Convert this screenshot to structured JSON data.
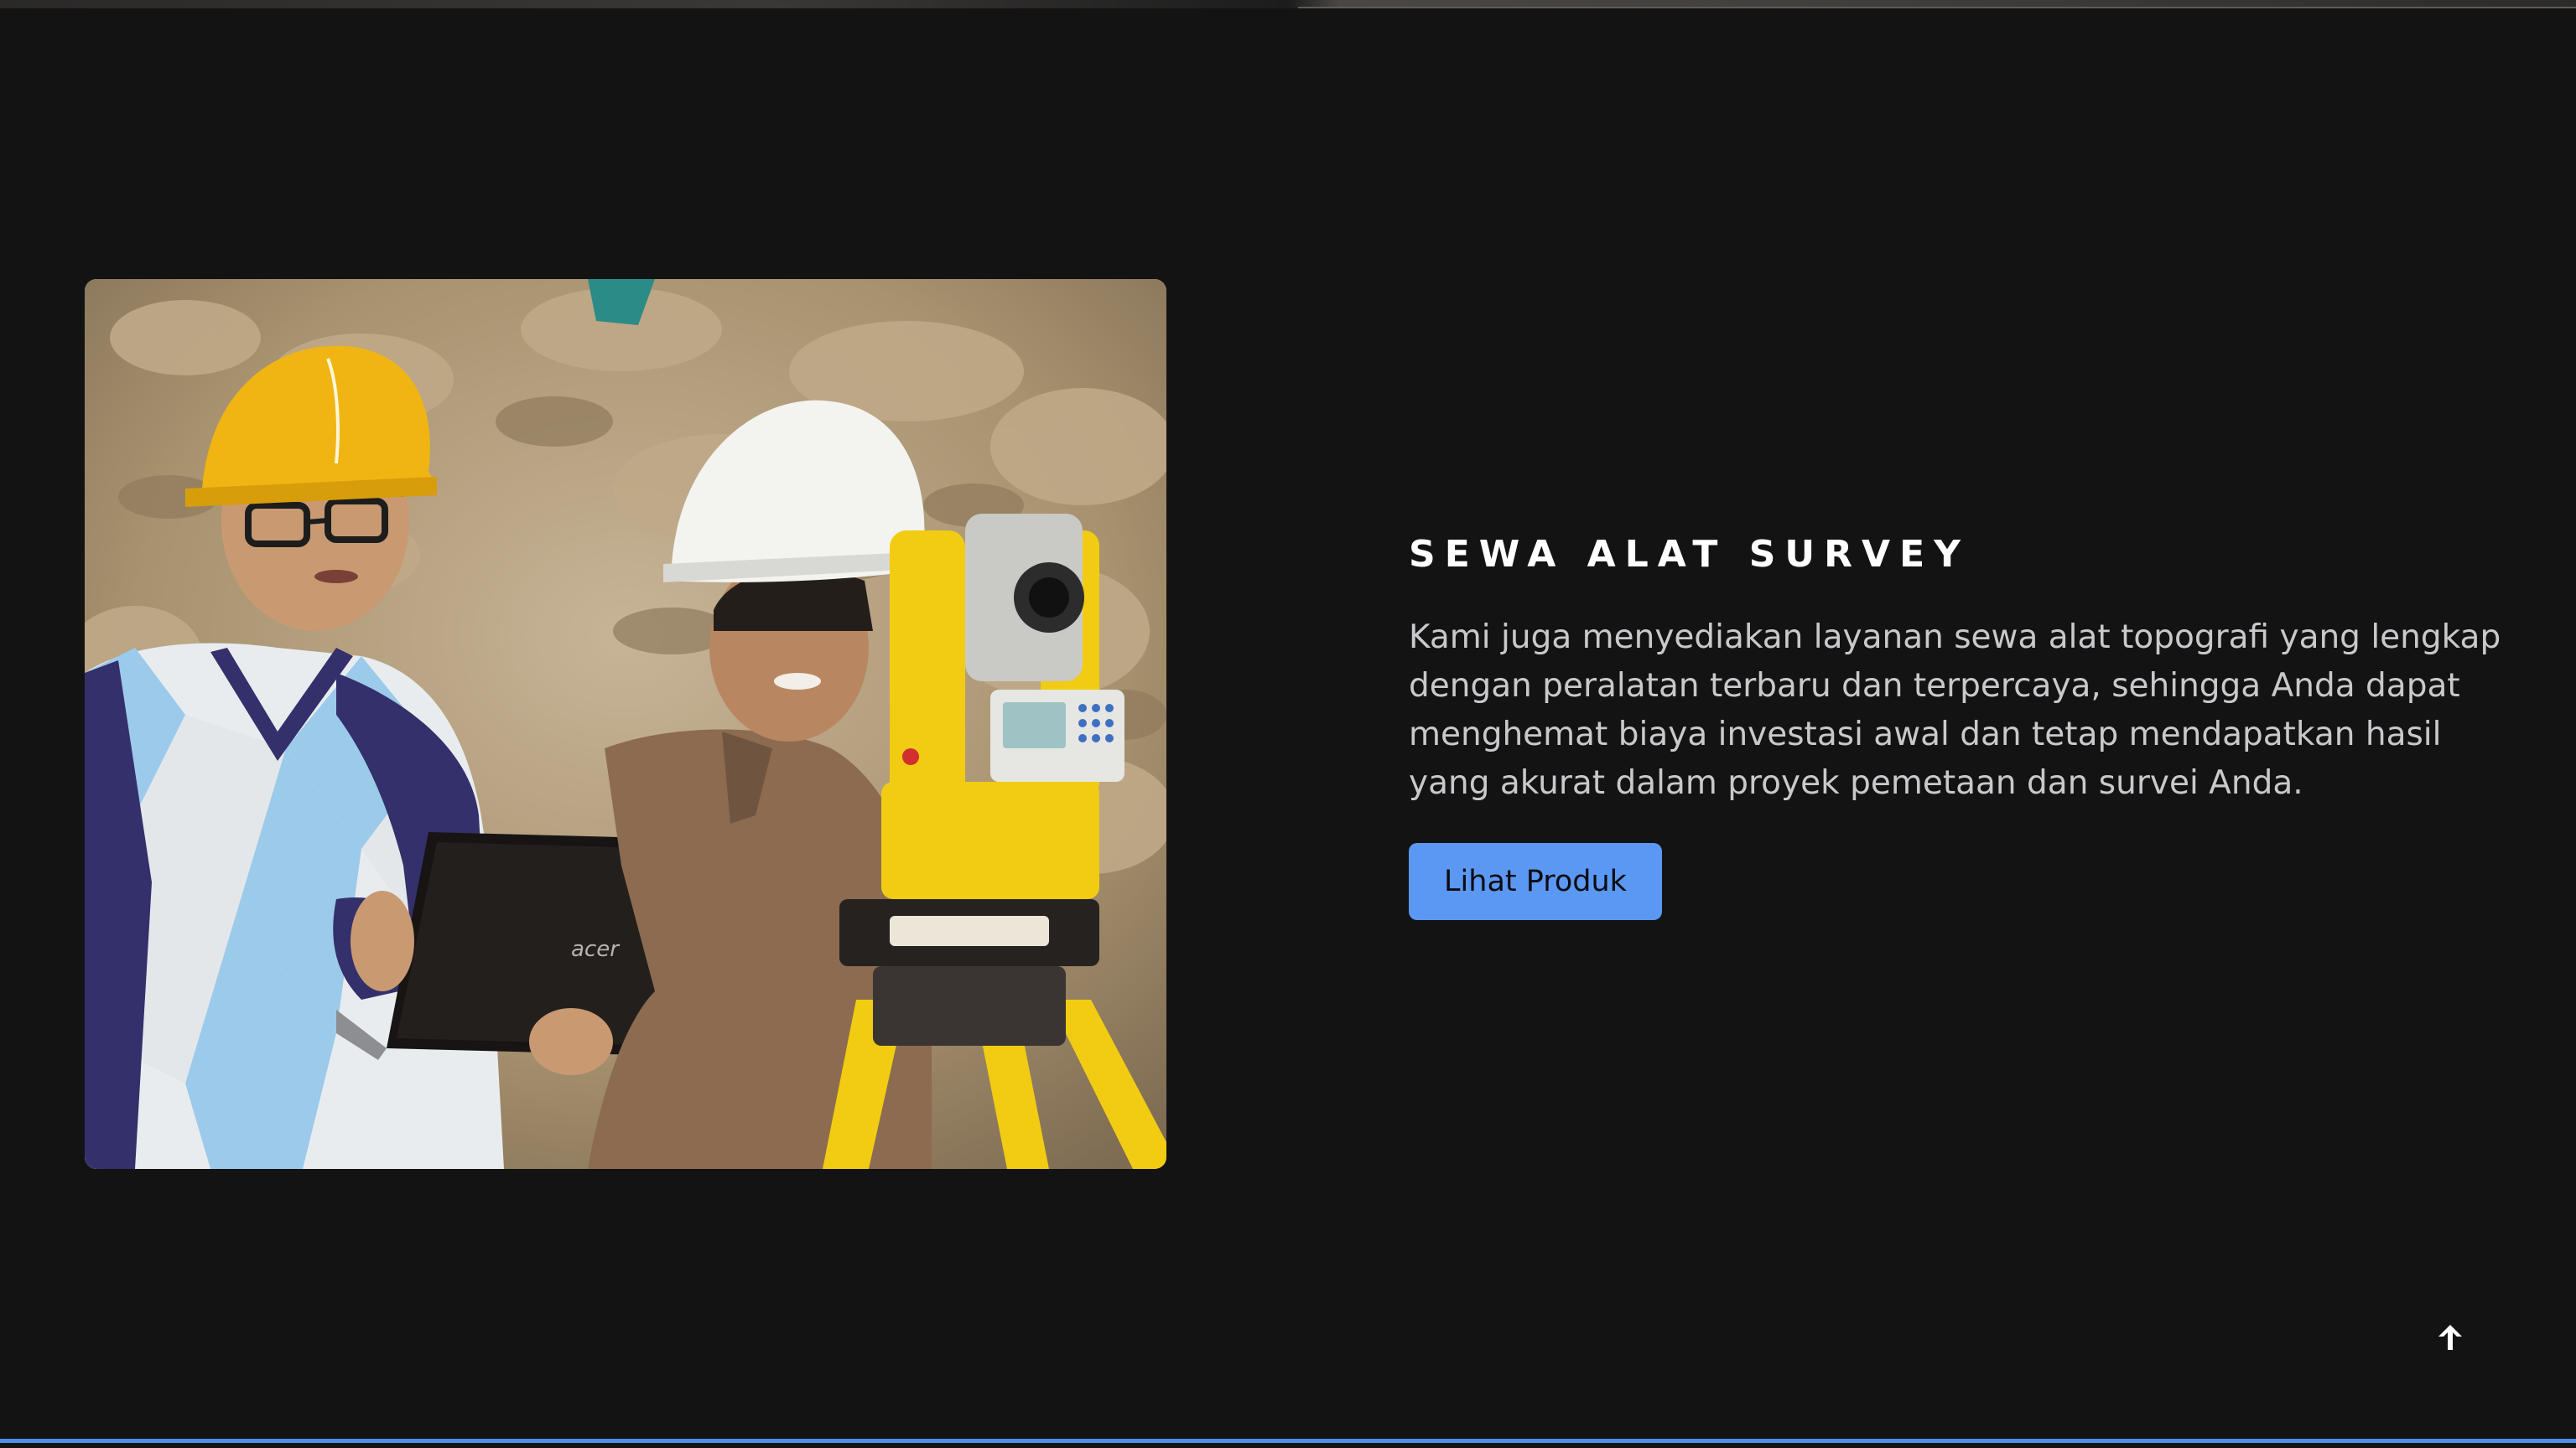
{
  "section": {
    "heading": "SEWA ALAT SURVEY",
    "description": "Kami juga menyediakan layanan sewa alat topografi yang lengkap dengan peralatan terbaru dan terpercaya, sehingga Anda dapat menghemat biaya investasi awal dan tetap mendapatkan hasil yang akurat dalam proyek pemetaan dan survei Anda.",
    "cta_label": "Lihat Produk"
  },
  "photo": {
    "laptop_brand": "acer"
  },
  "colors": {
    "background": "#131314",
    "accent": "#5b98f3",
    "heading": "#ffffff",
    "body_text": "#c9c9cc"
  },
  "icons": {
    "scroll_top": "arrow-up-icon"
  }
}
